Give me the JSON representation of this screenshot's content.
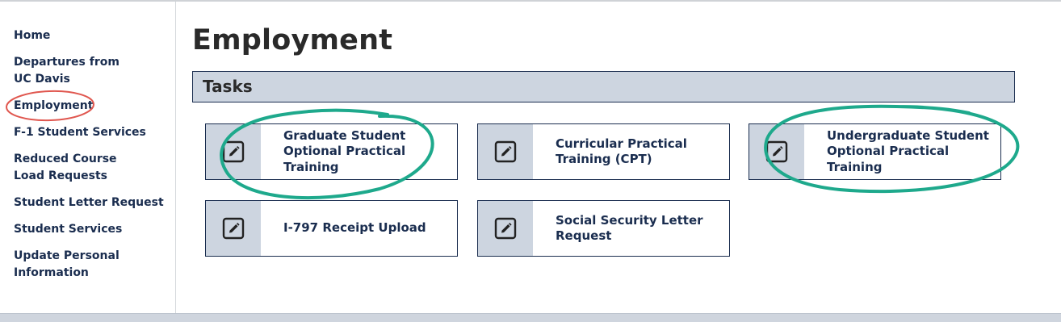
{
  "sidebar": {
    "items": [
      {
        "label": "Home"
      },
      {
        "label": "Departures from UC Davis"
      },
      {
        "label": "Employment"
      },
      {
        "label": "F-1 Student Services"
      },
      {
        "label": "Reduced Course Load Requests"
      },
      {
        "label": "Student Letter Request"
      },
      {
        "label": "Student Services"
      },
      {
        "label": "Update Personal Information"
      }
    ]
  },
  "main": {
    "title": "Employment",
    "section_title": "Tasks",
    "tasks": [
      {
        "label": "Graduate Student Optional Practical Training",
        "icon": "edit-icon"
      },
      {
        "label": "Curricular Practical Training (CPT)",
        "icon": "edit-icon"
      },
      {
        "label": "Undergraduate Student Optional Practical Training",
        "icon": "edit-icon"
      },
      {
        "label": "I-797 Receipt Upload",
        "icon": "edit-icon"
      },
      {
        "label": "Social Security Letter Request",
        "icon": "edit-icon"
      }
    ]
  },
  "annotations": {
    "highlight_colors": {
      "red": "#e0574f",
      "green": "#1ea98c"
    }
  }
}
